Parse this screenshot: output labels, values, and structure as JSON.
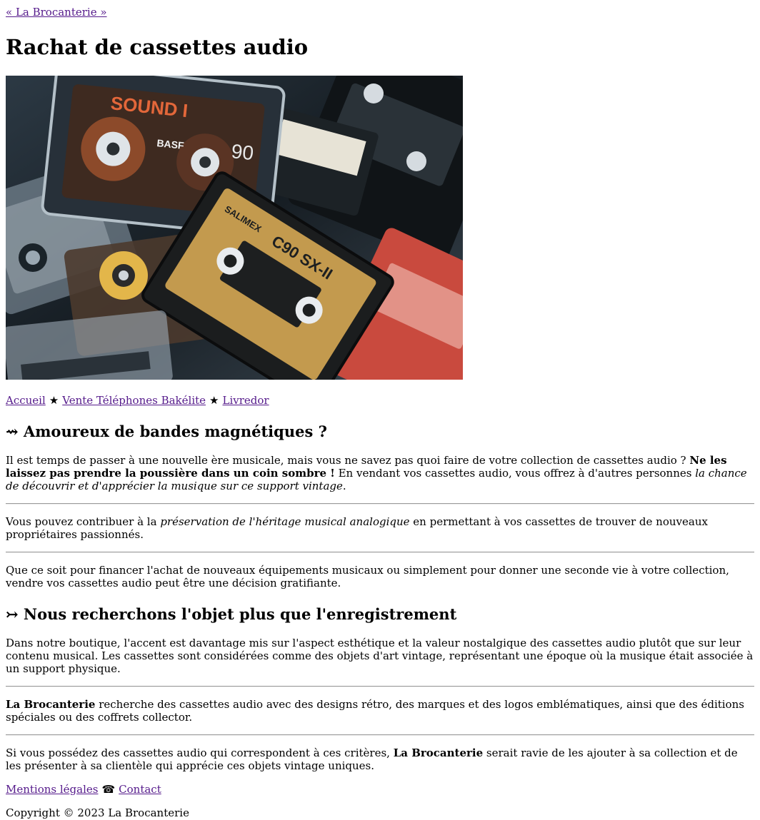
{
  "breadcrumb": {
    "label": "« La Brocanterie »"
  },
  "page_title": "Rachat de cassettes audio",
  "hero": {
    "alt": "Cassettes audio",
    "labels": {
      "tape1": "SOUND I",
      "tape1_brand": "BASF",
      "tape1_len": "90",
      "tape2_brand": "SALIMEX",
      "tape2_model": "C90 SX-II"
    }
  },
  "nav": {
    "items": [
      {
        "label": "Accueil"
      },
      {
        "label": "Vente Téléphones Bakélite"
      },
      {
        "label": "Livredor"
      }
    ],
    "separator": "★"
  },
  "section1": {
    "icon": "⇝",
    "title": "Amoureux de bandes magnétiques ?",
    "p1_a": "Il est temps de passer à une nouvelle ère musicale, mais vous ne savez pas quoi faire de votre collection de cassettes audio ? ",
    "p1_bold": "Ne les laissez pas prendre la poussière dans un coin sombre !",
    "p1_b": " En vendant vos cassettes audio, vous offrez à d'autres personnes ",
    "p1_italic": "la chance de découvrir et d'apprécier la musique sur ce support vintage",
    "p1_c": ".",
    "p2_a": "Vous pouvez contribuer à la ",
    "p2_italic": "préservation de l'héritage musical analogique",
    "p2_b": " en permettant à vos cassettes de trouver de nouveaux propriétaires passionnés.",
    "p3": "Que ce soit pour financer l'achat de nouveaux équipements musicaux ou simplement pour donner une seconde vie à votre collection, vendre vos cassettes audio peut être une décision gratifiante."
  },
  "section2": {
    "icon": "↣",
    "title": "Nous recherchons l'objet plus que l'enregistrement",
    "p1": "Dans notre boutique, l'accent est davantage mis sur l'aspect esthétique et la valeur nostalgique des cassettes audio plutôt que sur leur contenu musical. Les cassettes sont considérées comme des objets d'art vintage, représentant une époque où la musique était associée à un support physique.",
    "p2_bold": "La Brocanterie",
    "p2_rest": " recherche des cassettes audio avec des designs rétro, des marques et des logos emblématiques, ainsi que des éditions spéciales ou des coffrets collector.",
    "p3_a": "Si vous possédez des cassettes audio qui correspondent à ces critères, ",
    "p3_bold": "La Brocanterie",
    "p3_b": " serait ravie de les ajouter à sa collection et de les présenter à sa clientèle qui apprécie ces objets vintage uniques."
  },
  "footer": {
    "legal": "Mentions légales",
    "phone_icon": "☎",
    "contact": "Contact",
    "copyright": "Copyright © 2023 La Brocanterie"
  }
}
